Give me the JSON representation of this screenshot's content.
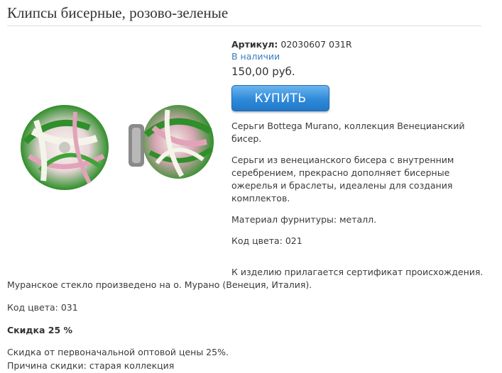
{
  "product": {
    "title": "Клипсы бисерные, розово-зеленые",
    "sku_label": "Артикул:",
    "sku_value": "02030607 031R",
    "availability": "В наличии",
    "price": "150,00 руб.",
    "buy_label": "КУПИТЬ"
  },
  "description": {
    "p1": "Серьги Bottega Murano, коллекция Венецианский бисер.",
    "p2": "Серьги из венецианского бисера с внутренним серебрением, прекрасно дополняет бисерные ожерелья и браслеты, идеалены для создания комплектов.",
    "p3": "Материал фурнитуры: металл.",
    "p4": "Код цвета: 021",
    "p5": "К изделию прилагается сертификат происхождения. Муранское стекло произведено на о. Мурано (Венеция, Италия).",
    "p6": "Код цвета: 031",
    "discount_title": "Скидка 25 %",
    "discount_line1": "Скидка от первоначальной оптовой цены 25%.",
    "discount_line2": "Причина скидки: старая коллекция"
  },
  "colors": {
    "accent": "#3a7cc1",
    "button": "#2f8ad9",
    "bead_green": "#2f8f2a",
    "bead_pink": "#e2a3b8",
    "bead_white": "#f4f4ea"
  }
}
